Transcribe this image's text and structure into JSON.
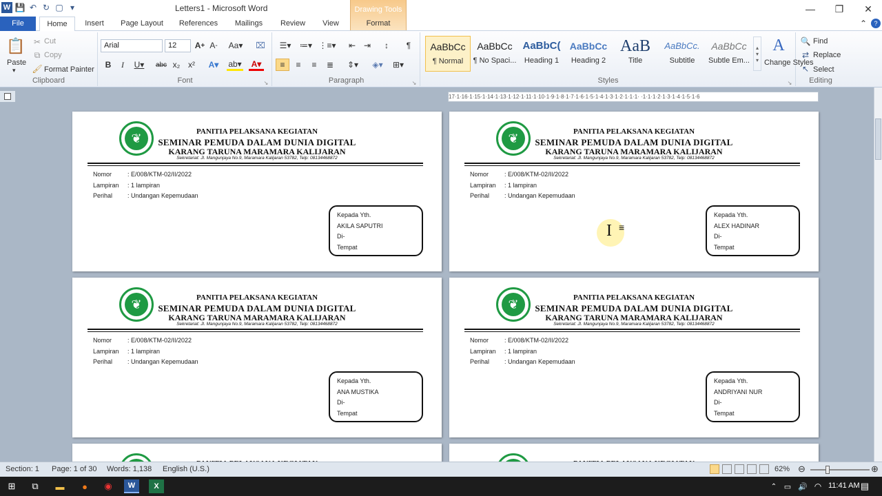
{
  "window": {
    "title": "Letters1 - Microsoft Word",
    "context_tab_group": "Drawing Tools"
  },
  "tabs": [
    "File",
    "Home",
    "Insert",
    "Page Layout",
    "References",
    "Mailings",
    "Review",
    "View",
    "Format"
  ],
  "active_tab": "Home",
  "ribbon": {
    "clipboard": {
      "label": "Clipboard",
      "paste": "Paste",
      "cut": "Cut",
      "copy": "Copy",
      "format_painter": "Format Painter"
    },
    "font": {
      "label": "Font",
      "name": "Arial",
      "size": "12"
    },
    "paragraph": {
      "label": "Paragraph"
    },
    "styles": {
      "label": "Styles",
      "items": [
        {
          "preview": "AaBbCc",
          "name": "¶ Normal"
        },
        {
          "preview": "AaBbCc",
          "name": "¶ No Spaci..."
        },
        {
          "preview": "AaBbC(",
          "name": "Heading 1"
        },
        {
          "preview": "AaBbCc",
          "name": "Heading 2"
        },
        {
          "preview": "AaB",
          "name": "Title"
        },
        {
          "preview": "AaBbCc.",
          "name": "Subtitle"
        },
        {
          "preview": "AaBbCc",
          "name": "Subtle Em..."
        }
      ],
      "change_styles": "Change Styles"
    },
    "editing": {
      "label": "Editing",
      "find": "Find",
      "replace": "Replace",
      "select": "Select"
    }
  },
  "ruler_text": "17·1·16·1·15·1·14·1·13·1·12·1·11·1·10·1·9·1·8·1·7·1·6·1·5·1·4·1·3·1·2·1·1·1· ·1·1·1·2·1·3·1·4·1·5·1·6",
  "letter": {
    "h1": "PANITIA PELAKSANA KEGIATAN",
    "h2": "SEMINAR PEMUDA DALAM DUNIA DIGITAL",
    "h3": "KARANG TARUNA MARAMARA KALIJARAN",
    "secretariat": "Sekretariat: Jl. Mangunjaya No.9, Maramara Kalijaran 53782, Telp: 08134468872",
    "nomor_label": "Nomor",
    "nomor": ": E/008/KTM-02/II/2022",
    "lampiran_label": "Lampiran",
    "lampiran": ": 1 lampiran",
    "perihal_label": "Perihal",
    "perihal": ": Undangan Kepemudaan",
    "kepada": "Kepada Yth.",
    "di": "Di-",
    "tempat": "Tempat"
  },
  "recipients": [
    "AKILA SAPUTRI",
    "ALEX HADINAR",
    "ANA MUSTIKA",
    "ANDRIYANI NUR"
  ],
  "status": {
    "section": "Section: 1",
    "page": "Page: 1 of 30",
    "words": "Words: 1,138",
    "language": "English (U.S.)",
    "zoom": "62%"
  },
  "clock": "11:41 AM"
}
